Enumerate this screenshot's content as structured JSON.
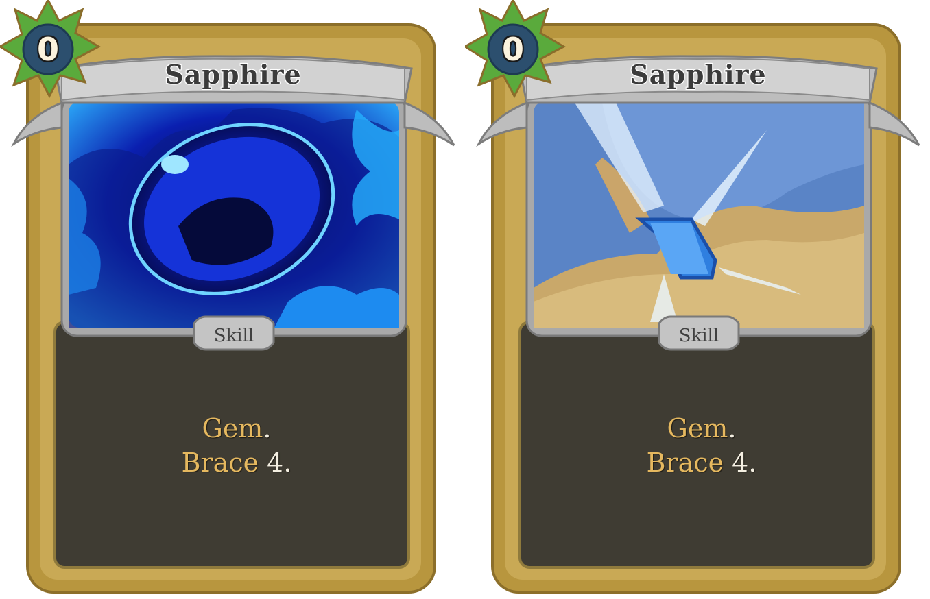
{
  "cards": [
    {
      "title": "Sapphire",
      "cost": "0",
      "type": "Skill",
      "desc_line1_kw": "Gem",
      "desc_line1_rest": ".",
      "desc_line2_kw": "Brace",
      "desc_line2_rest": " 4.",
      "art": "sapphire-gem-art"
    },
    {
      "title": "Sapphire",
      "cost": "0",
      "type": "Skill",
      "desc_line1_kw": "Gem",
      "desc_line1_rest": ".",
      "desc_line2_kw": "Brace",
      "desc_line2_rest": " 4.",
      "art": "gem-socket-art"
    }
  ],
  "colors": {
    "frame_gold": "#b8963e",
    "body_dark": "#3f3c33",
    "banner_silver": "#c8c8c8",
    "keyword_gold": "#e5b85f",
    "cost_badge_green": "#5aaa3c",
    "cost_badge_blue": "#2c4f6e"
  }
}
